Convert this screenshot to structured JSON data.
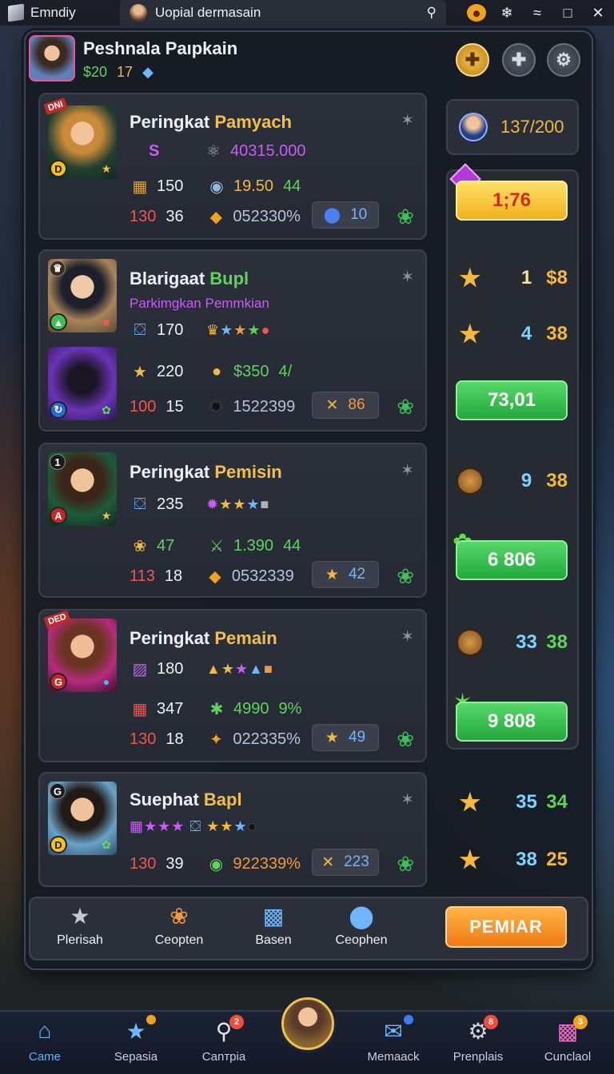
{
  "titlebar": {
    "app_name": "Emndiy",
    "tab_title": "Uopial dermasain",
    "icons": [
      "cube-icon",
      "avatar-icon",
      "search-icon",
      "notification-icon",
      "settings-icon",
      "wifi-icon",
      "maximize-icon",
      "close-icon"
    ]
  },
  "player": {
    "name": "Peshnala Paıpkain",
    "money": "$20",
    "level": "17"
  },
  "cards": [
    {
      "title_a": "Peringkat ",
      "title_b": "Pamyach",
      "badge": "DNI",
      "sub_letter": "S",
      "sub_value": "40315.000",
      "row1_a": "150",
      "row1_b": "19.50",
      "row1_c": "44",
      "row2_a": "130",
      "row2_b": "36",
      "row2_c": "052330%",
      "chip": "10"
    },
    {
      "title_a": "Blarigaat ",
      "title_b": "Bupl",
      "sub": "Parkimgkan Pemmkian",
      "row1_a": "170",
      "row2_a": "220",
      "row2_b": "$350",
      "row2_c": "4/",
      "row3_a": "100",
      "row3_b": "15",
      "row3_c": "1522399",
      "chip": "86"
    },
    {
      "title_a": "Peringkat ",
      "title_b": "Pemisin",
      "badge_num": "1",
      "row1_a": "235",
      "row2_a": "47",
      "row2_b": "1.390",
      "row2_c": "44",
      "row3_a": "113",
      "row3_b": "18",
      "row3_c": "0532339",
      "chip": "42"
    },
    {
      "title_a": "Peringkat ",
      "title_b": "Pemain",
      "badge": "DED",
      "row1_a": "180",
      "row2_a": "347",
      "row2_b": "4990",
      "row2_c": "9%",
      "row3_a": "130",
      "row3_b": "18",
      "row3_c": "022335%",
      "chip": "49"
    },
    {
      "title_a": "Suephat ",
      "title_b": "Bapl",
      "badge_num": "G",
      "row2_a": "130",
      "row2_b": "39",
      "row2_c": "922339%",
      "chip": "223"
    }
  ],
  "right": {
    "counter": "137/200",
    "yellow_btn": "1;76",
    "stat1_a": "1",
    "stat1_b": "$8",
    "stat2_a": "4",
    "stat2_b": "38",
    "green1": "73,01",
    "stat3_a": "9",
    "stat3_b": "38",
    "green2": "6 806",
    "stat4_a": "33",
    "stat4_b": "38",
    "green3": "9 808",
    "stat5_a": "35",
    "stat5_b": "34",
    "stat6_a": "38",
    "stat6_b": "25"
  },
  "actions": {
    "a1": "Plerisah",
    "a2": "Ceopten",
    "a3": "Basen",
    "a4": "Ceophen",
    "primary": "PEMIAR"
  },
  "nav": {
    "n1": "Came",
    "n2": "Sepasia",
    "n3": "Canтpia",
    "n4": "Memaack",
    "n5": "Prenplais",
    "n6": "Cunclaol",
    "badges": {
      "n2": "",
      "n3": "2",
      "n4": "",
      "n5": "8",
      "n6": "3"
    }
  },
  "colors": {
    "accent_gold": "#f2c04a",
    "accent_green": "#3fbf5a",
    "primary_orange": "#f07a14",
    "active_nav": "#5cb4ff"
  }
}
